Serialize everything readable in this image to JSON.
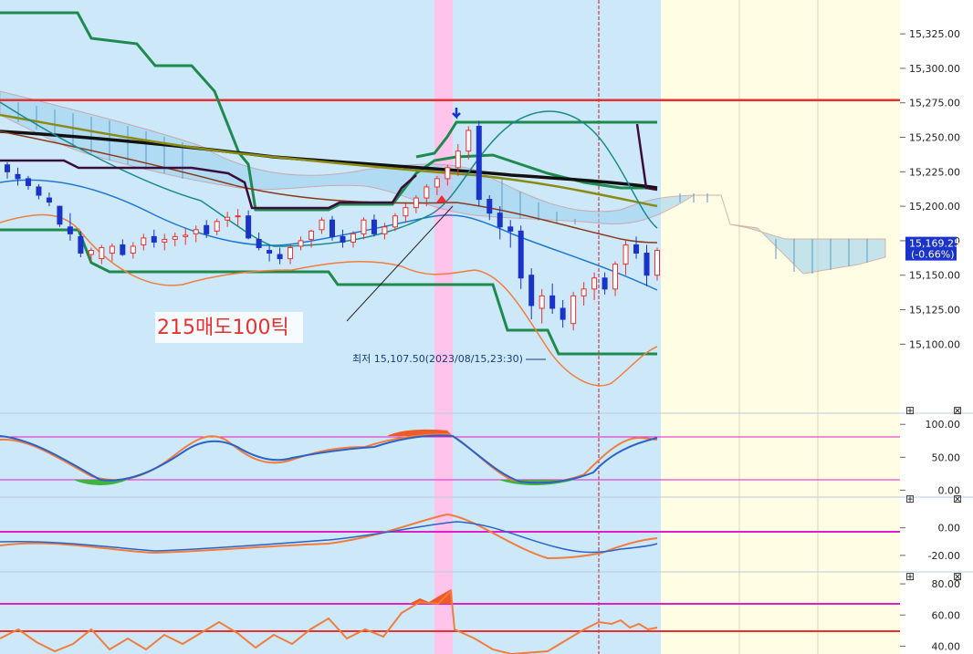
{
  "chart_data": [
    {
      "type": "candlestick",
      "panel": "price",
      "ylim": [
        15085,
        15335
      ],
      "y_ticks": [
        "15,325.00",
        "15,300.00",
        "15,275.00",
        "15,250.00",
        "15,225.00",
        "15,200.00",
        "15,175.00",
        "15,150.00",
        "15,125.00",
        "15,100.00"
      ],
      "y_tick_values": [
        15325,
        15300,
        15275,
        15250,
        15225,
        15200,
        15175,
        15150,
        15125,
        15100
      ],
      "current_price_label": "15,169.25",
      "current_change_label": "(-0.66%)",
      "current_price": 15169.25,
      "horizontal_line": 15277,
      "annotation": "215매도100틱",
      "low_label": "최저 15,107.50(2023/08/15,23:30)",
      "low_value": 15107.5,
      "candles": [
        [
          15230,
          15232,
          15220,
          15225
        ],
        [
          15223,
          15228,
          15215,
          15220
        ],
        [
          15220,
          15222,
          15212,
          15215
        ],
        [
          15214,
          15216,
          15205,
          15208
        ],
        [
          15206,
          15210,
          15200,
          15203
        ],
        [
          15200,
          15200,
          15185,
          15187
        ],
        [
          15185,
          15195,
          15175,
          15180
        ],
        [
          15178,
          15182,
          15163,
          15166
        ],
        [
          15165,
          15170,
          15160,
          15168
        ],
        [
          15162,
          15172,
          15158,
          15170
        ],
        [
          15166,
          15173,
          15160,
          15171
        ],
        [
          15172,
          15176,
          15164,
          15165
        ],
        [
          15166,
          15174,
          15162,
          15171
        ],
        [
          15172,
          15180,
          15168,
          15177
        ],
        [
          15178,
          15183,
          15170,
          15174
        ],
        [
          15174,
          15180,
          15168,
          15176
        ],
        [
          15176,
          15181,
          15171,
          15178
        ],
        [
          15178,
          15184,
          15172,
          15179
        ],
        [
          15180,
          15186,
          15174,
          15183
        ],
        [
          15186,
          15190,
          15177,
          15180
        ],
        [
          15182,
          15191,
          15179,
          15189
        ],
        [
          15190,
          15196,
          15185,
          15192
        ],
        [
          15193,
          15198,
          15186,
          15193
        ],
        [
          15193,
          15197,
          15176,
          15177
        ],
        [
          15176,
          15181,
          15168,
          15170
        ],
        [
          15168,
          15172,
          15160,
          15166
        ],
        [
          15165,
          15170,
          15158,
          15162
        ],
        [
          15162,
          15172,
          15158,
          15170
        ],
        [
          15171,
          15178,
          15168,
          15175
        ],
        [
          15176,
          15183,
          15170,
          15182
        ],
        [
          15183,
          15192,
          15180,
          15190
        ],
        [
          15190,
          15193,
          15175,
          15178
        ],
        [
          15178,
          15183,
          15170,
          15174
        ],
        [
          15174,
          15182,
          15170,
          15180
        ],
        [
          15180,
          15192,
          15176,
          15190
        ],
        [
          15190,
          15194,
          15178,
          15180
        ],
        [
          15180,
          15188,
          15176,
          15185
        ],
        [
          15185,
          15195,
          15182,
          15193
        ],
        [
          15193,
          15202,
          15188,
          15199
        ],
        [
          15199,
          15208,
          15195,
          15206
        ],
        [
          15206,
          15216,
          15200,
          15214
        ],
        [
          15214,
          15222,
          15208,
          15220
        ],
        [
          15220,
          15230,
          15215,
          15228
        ],
        [
          15228,
          15245,
          15222,
          15240
        ],
        [
          15240,
          15258,
          15234,
          15255
        ],
        [
          15258,
          15262,
          15200,
          15205
        ],
        [
          15205,
          15208,
          15190,
          15195
        ],
        [
          15195,
          15200,
          15176,
          15185
        ],
        [
          15185,
          15190,
          15170,
          15182
        ],
        [
          15182,
          15186,
          15140,
          15148
        ],
        [
          15150,
          15155,
          15118,
          15128
        ],
        [
          15126,
          15140,
          15115,
          15135
        ],
        [
          15135,
          15144,
          15122,
          15126
        ],
        [
          15126,
          15132,
          15112,
          15118
        ],
        [
          15115,
          15138,
          15110,
          15135
        ],
        [
          15135,
          15145,
          15128,
          15140
        ],
        [
          15140,
          15152,
          15132,
          15148
        ],
        [
          15148,
          15152,
          15136,
          15140
        ],
        [
          15140,
          15160,
          15135,
          15158
        ],
        [
          15158,
          15175,
          15150,
          15172
        ],
        [
          15172,
          15178,
          15162,
          15166
        ],
        [
          15166,
          15172,
          15142,
          15150
        ],
        [
          15150,
          15170,
          15146,
          15168
        ]
      ]
    },
    {
      "type": "line",
      "panel": "oscillator-1",
      "ylim": [
        -5,
        110
      ],
      "y_ticks": [
        "100.00",
        "50.00",
        "0.00"
      ],
      "y_tick_values": [
        100,
        50,
        0
      ],
      "ref_lines": [
        80,
        20
      ]
    },
    {
      "type": "line",
      "panel": "oscillator-2",
      "ylim": [
        -30,
        15
      ],
      "y_ticks": [
        "0.00",
        "-20.00"
      ],
      "y_tick_values": [
        0,
        -20
      ],
      "ref_lines": [
        0
      ]
    },
    {
      "type": "line",
      "panel": "oscillator-3",
      "ylim": [
        35,
        90
      ],
      "y_ticks": [
        "80.00",
        "60.00",
        "40.00"
      ],
      "y_tick_values": [
        80,
        60,
        40
      ],
      "ref_lines": [
        70,
        50
      ]
    }
  ],
  "panel_buttons": {
    "icon_a": "panel-menu-icon",
    "icon_b": "panel-close-icon",
    "label_a": "⊞",
    "label_b": "⊠"
  },
  "colors": {
    "plot_bg": "#cde9f9",
    "future_bg": "#fffde4",
    "highlight": "#ffc4ec",
    "up": "#e8312f",
    "down": "#1a33c9",
    "hline": "#e8312f",
    "envelope": "#1f8a4f"
  }
}
